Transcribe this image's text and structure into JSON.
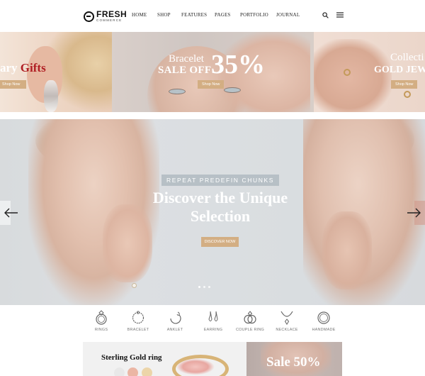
{
  "header": {
    "logo_main": "FRESH",
    "logo_sub": "COMMERCE",
    "nav": [
      "HOME",
      "SHOP",
      "FEATURES",
      "PAGES",
      "PORTFOLIO",
      "JOURNAL"
    ]
  },
  "banners": {
    "left": {
      "title_part1": "ary",
      "title_part2": "Gifts",
      "button": "Shop Now"
    },
    "middle": {
      "line1": "Bracelet",
      "line2": "SALE OFF",
      "percent": "35%",
      "button": "Shop Now"
    },
    "right": {
      "line1": "Collecti",
      "line2": "GOLD JEW",
      "button": "Shop Now"
    }
  },
  "hero": {
    "kicker": "REPEAT PREDEFIN CHUNKS",
    "title": "Discover the Unique Selection",
    "button": "DISCOVER NOW"
  },
  "categories": [
    {
      "label": "RINGS",
      "icon": "ring-icon"
    },
    {
      "label": "BRACELET",
      "icon": "bracelet-icon"
    },
    {
      "label": "ANKLET",
      "icon": "anklet-icon"
    },
    {
      "label": "EARRING",
      "icon": "earring-icon"
    },
    {
      "label": "COUPLE RING",
      "icon": "couple-ring-icon"
    },
    {
      "label": "NECKLACE",
      "icon": "necklace-icon"
    },
    {
      "label": "HANDMADE",
      "icon": "handmade-icon"
    }
  ],
  "promos": {
    "left_title": "Sterling Gold ring",
    "right_title": "Sale 50%"
  },
  "colors": {
    "accent": "#d3ae83",
    "brand_red": "#b01e23"
  }
}
